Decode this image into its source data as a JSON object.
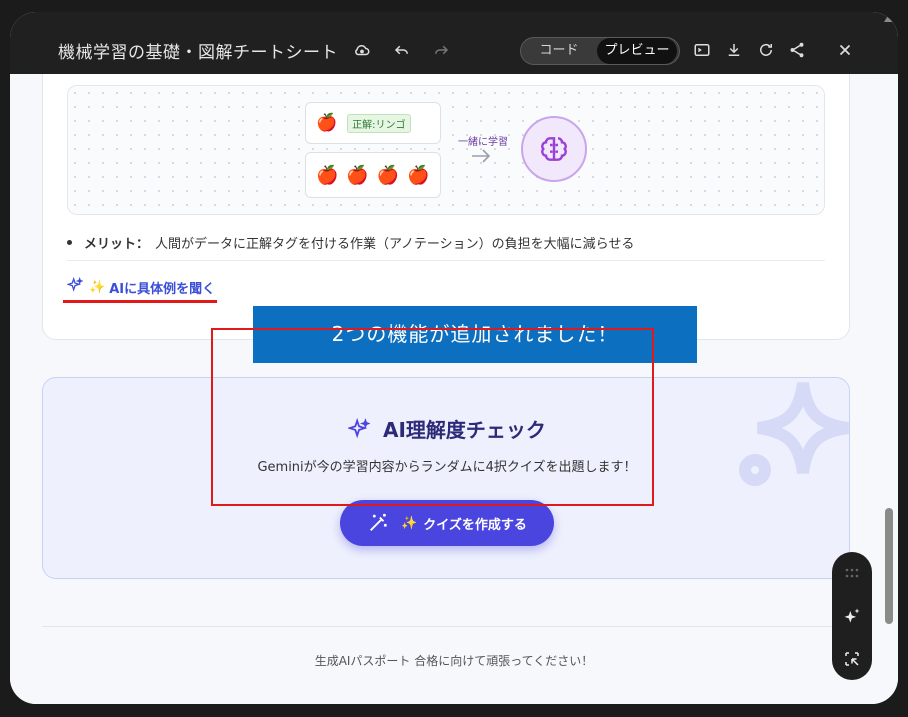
{
  "window": {
    "title": "機械学習の基礎・図解チートシート",
    "view_toggle": {
      "code": "コード",
      "preview": "プレビュー",
      "selected": "プレビュー"
    }
  },
  "diagram": {
    "box1_tag": "正解:リンゴ",
    "arrow_label": "一緒に学習",
    "apple_emoji": "🍎"
  },
  "merit": {
    "label": "メリット：",
    "text": "人間がデータに正解タグを付ける作業（アノテーション）の負担を大幅に減らせる"
  },
  "ask_ai": {
    "emoji": "✨",
    "label": "AIに具体例を聞く"
  },
  "banner": {
    "text": "2つの機能が追加されました！"
  },
  "quiz": {
    "title": "AI理解度チェック",
    "description": "Geminiが今の学習内容からランダムに4択クイズを出題します！",
    "button_emoji": "✨",
    "button_label": "クイズを作成する"
  },
  "footer": {
    "text": "生成AIパスポート 合格に向けて頑張ってください！"
  },
  "colors": {
    "accent": "#4b45e0",
    "banner": "#0c6fbf",
    "highlight": "#e01a1a"
  }
}
